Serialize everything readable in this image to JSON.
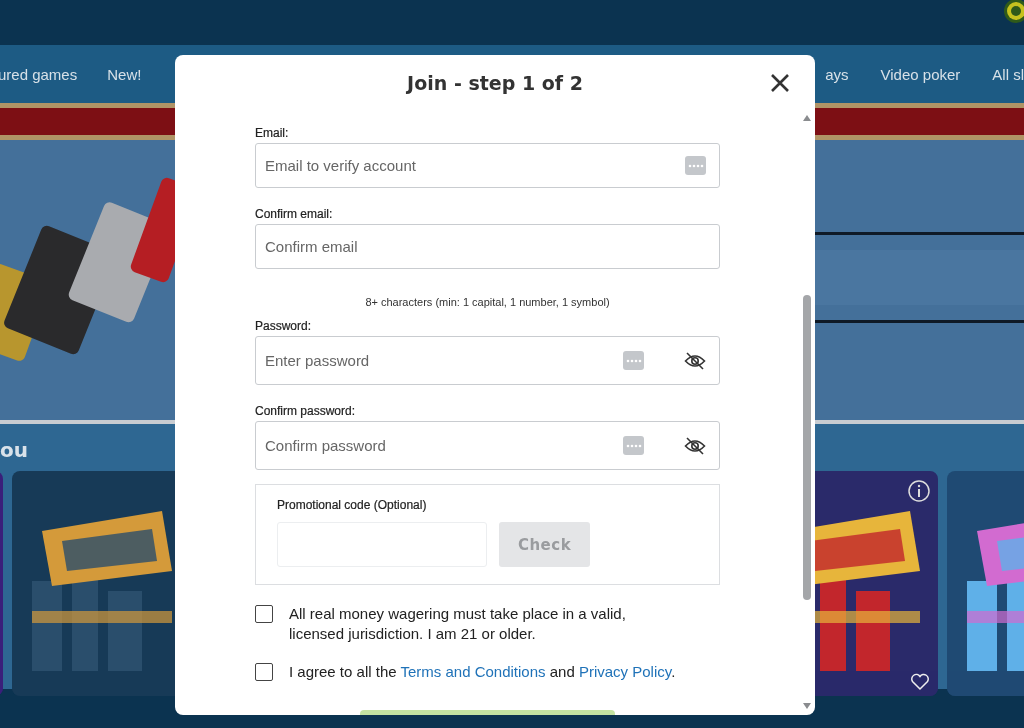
{
  "page": {
    "nav": {
      "left": [
        "ured games",
        "New!"
      ],
      "right": [
        "ays",
        "Video poker",
        "All sl"
      ]
    },
    "section_heading": "ou"
  },
  "modal": {
    "title": "Join - step 1 of 2",
    "fields": [
      {
        "kind": "email",
        "label": "Email:",
        "placeholder": "Email to verify account"
      },
      {
        "kind": "plain",
        "label": "Confirm email:",
        "placeholder": "Confirm email"
      },
      {
        "kind": "password",
        "hint": "8+ characters (min: 1 capital, 1 number, 1 symbol)",
        "label": "Password:",
        "placeholder": "Enter password"
      },
      {
        "kind": "password",
        "label": "Confirm password:",
        "placeholder": "Confirm password"
      }
    ],
    "promo": {
      "label": "Promotional code (Optional)",
      "button": "Check",
      "disabled": true
    },
    "agreements": [
      {
        "checked": false,
        "parts": [
          {
            "kind": "text",
            "text": "All real money wagering must take place in a valid, licensed jurisdiction. I am 21 or older."
          }
        ]
      },
      {
        "checked": false,
        "parts": [
          {
            "kind": "text",
            "text": "I agree to all the "
          },
          {
            "kind": "link",
            "text": "Terms and Conditions"
          },
          {
            "kind": "text",
            "text": " and "
          },
          {
            "kind": "link",
            "text": "Privacy Policy"
          },
          {
            "kind": "text",
            "text": "."
          }
        ]
      }
    ]
  }
}
